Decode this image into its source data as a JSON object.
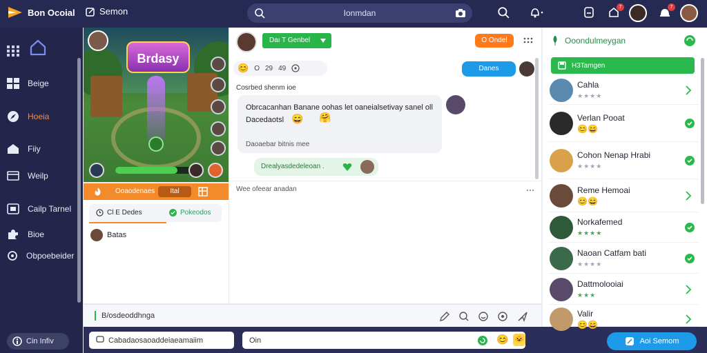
{
  "topbar": {
    "brand": "Bon Ocoial",
    "stream_tab": "Semon",
    "search_placeholder": "Ionmdan",
    "notif_count_1": "7",
    "notif_count_2": "7"
  },
  "sidebar": {
    "items": [
      {
        "label": "Beige",
        "icon": "grid-icon"
      },
      {
        "label": "Hoeia",
        "icon": "compass-icon"
      },
      {
        "label": "Fiiy",
        "icon": "home-icon"
      },
      {
        "label": "Weilp",
        "icon": "card-icon"
      },
      {
        "label": "Cailp Tarnel",
        "icon": "media-icon"
      },
      {
        "label": "Bioe",
        "icon": "puzzle-icon"
      },
      {
        "label": "Obpoebeider",
        "icon": "settings-icon"
      }
    ],
    "bottom_button": "Cin Infiv"
  },
  "stream": {
    "game_title": "Brdasy",
    "bar_label": "Ooaodenaes",
    "bar_button": "Ital",
    "tab_1": "Cl E Dedes",
    "tab_2": "Pokeodos",
    "viewer_name": "Batas",
    "health_fraction": 0.75
  },
  "chat_header": {
    "channel_button": "Daı T Genbel",
    "orange_button": "O Ondel",
    "blue_button": "Danes",
    "reactions": [
      "O",
      "29",
      "49"
    ]
  },
  "chat": {
    "section_label": "Cosrbed shenm ioe",
    "message_text_1": "Obrcacanhan Banane oohas let oaneialsetivay sanel oll",
    "message_text_2": "Dacedaotsl",
    "message_meta": "Daoaebar bitnis mee",
    "green_message": "Drealyasdedeleoan .",
    "divider_label": "Wee ofeear anadan",
    "composer_placeholder": "B/osdeoddhnga"
  },
  "bottom_bar": {
    "input_1": "Cabadaosaoaddeiaeamaiim",
    "input_2": "Oin",
    "cta_label": "Aoi Semom"
  },
  "right_panel": {
    "title": "Ooondulmeygan",
    "green_button": "H3Tamgen",
    "people": [
      {
        "name": "Cahla",
        "sub": "★★★★",
        "end": "chevron",
        "sub_green": false,
        "has_emoji": false
      },
      {
        "name": "Verlan Pooat",
        "sub": "",
        "end": "check",
        "sub_green": false,
        "has_emoji": true
      },
      {
        "name": "Cohon Nenap Hrabi",
        "sub": "★★★★",
        "end": "check",
        "sub_green": false,
        "has_emoji": false
      },
      {
        "name": "Reme Hemoai",
        "sub": "",
        "end": "chevron",
        "sub_green": false,
        "has_emoji": true
      },
      {
        "name": "Norkafemed",
        "sub": "★★★★",
        "end": "check",
        "sub_green": true,
        "has_emoji": false
      },
      {
        "name": "Naoan Catfam bati",
        "sub": "★★★★",
        "end": "check",
        "sub_green": false,
        "has_emoji": false
      },
      {
        "name": "Dattmolooiai",
        "sub": "★★★",
        "end": "chevron",
        "sub_green": true,
        "has_emoji": false
      },
      {
        "name": "Valir",
        "sub": "",
        "end": "chevron",
        "sub_green": false,
        "has_emoji": true
      }
    ]
  },
  "colors": {
    "topbar": "#262a52",
    "sidebar": "#23264a",
    "accent_orange": "#f38b2a",
    "accent_green": "#2bb84c",
    "accent_blue": "#1e9be8"
  }
}
